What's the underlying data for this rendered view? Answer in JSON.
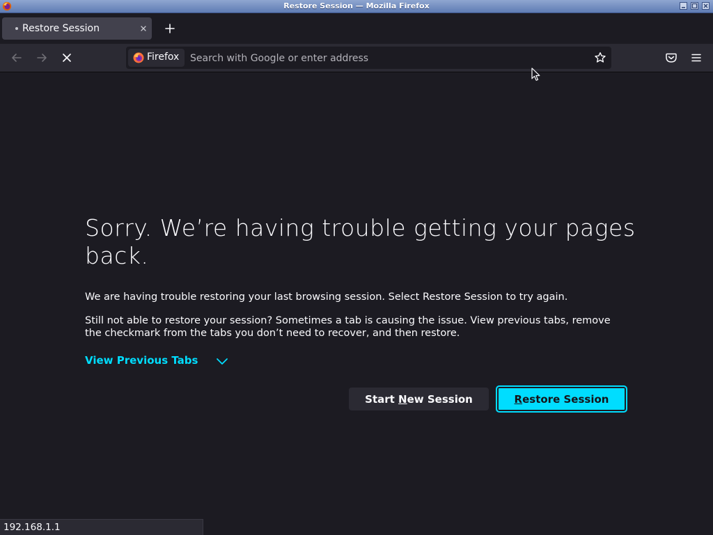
{
  "window": {
    "title": "Restore Session — Mozilla Firefox"
  },
  "tabs": [
    {
      "label": "Restore Session",
      "active": true
    }
  ],
  "toolbar": {
    "identity_label": "Firefox",
    "url_placeholder": "Search with Google or enter address",
    "url_value": ""
  },
  "icons": {
    "back": "back-arrow-icon",
    "forward": "forward-arrow-icon",
    "stop": "stop-x-icon",
    "bookmark": "star-icon",
    "pocket": "pocket-icon",
    "menu": "hamburger-menu-icon",
    "new_tab": "plus-icon",
    "tab_close": "close-icon",
    "disclosure": "chevron-down-icon"
  },
  "content": {
    "heading": "Sorry. We’re having trouble getting your pages back.",
    "paragraph1": "We are having trouble restoring your last browsing session. Select Restore Session to try again.",
    "paragraph2": "Still not able to restore your session? Sometimes a tab is causing the issue. View previous tabs, remove the checkmark from the tabs you don’t need to recover, and then restore.",
    "view_previous_tabs": "View Previous Tabs",
    "start_new_session": {
      "before": "Start ",
      "accesskey": "N",
      "after": "ew Session"
    },
    "restore_session": {
      "before": "",
      "accesskey": "R",
      "after": "estore Session"
    }
  },
  "status": {
    "text": "192.168.1.1"
  },
  "colors": {
    "accent": "#00ddff",
    "page_background": "#1c1b22",
    "toolbar_background": "#2b2a33",
    "text": "#fbfbfe"
  }
}
